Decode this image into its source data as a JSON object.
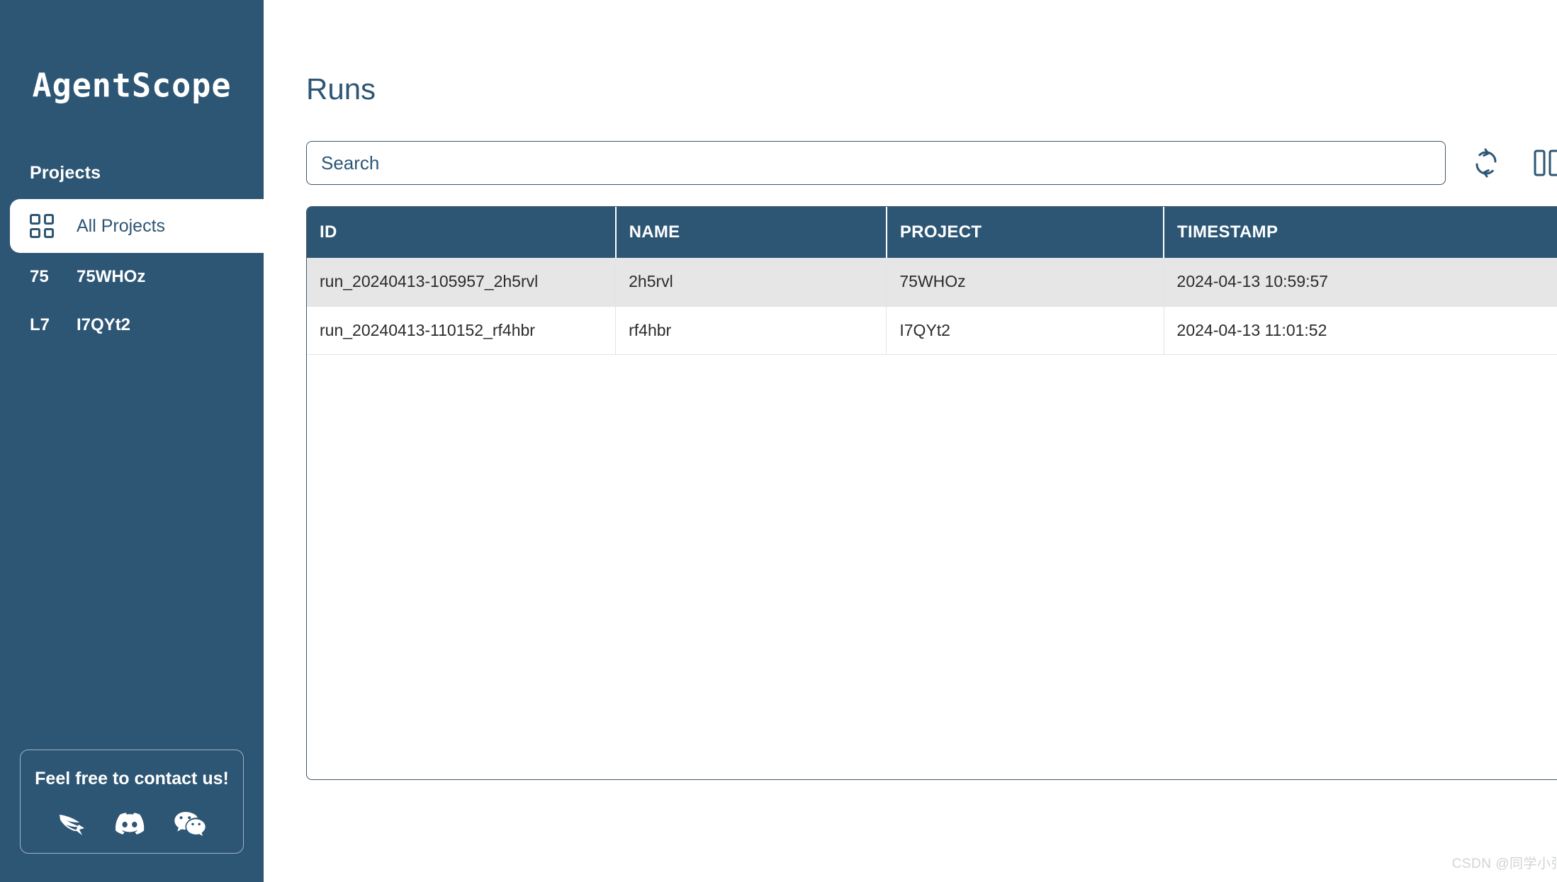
{
  "brand": {
    "logo_text": "AgentScope"
  },
  "sidebar": {
    "section_label": "Projects",
    "items": [
      {
        "abbr": "",
        "label": "All Projects",
        "icon": "grid-icon",
        "active": true
      },
      {
        "abbr": "75",
        "label": "75WHOz",
        "icon": "",
        "active": false
      },
      {
        "abbr": "L7",
        "label": "I7QYt2",
        "icon": "",
        "active": false
      }
    ],
    "contact": {
      "title": "Feel free to contact us!",
      "icons": [
        "dingtalk-icon",
        "discord-icon",
        "wechat-icon"
      ]
    }
  },
  "main": {
    "title": "Runs",
    "search": {
      "placeholder": "Search",
      "value": ""
    },
    "actions": [
      {
        "name": "refresh-icon",
        "label": "Refresh"
      },
      {
        "name": "columns-icon",
        "label": "Columns"
      }
    ],
    "table": {
      "columns": [
        "ID",
        "NAME",
        "PROJECT",
        "TIMESTAMP"
      ],
      "rows": [
        {
          "id": "run_20240413-105957_2h5rvl",
          "name": "2h5rvl",
          "project": "75WHOz",
          "timestamp": "2024-04-13 10:59:57"
        },
        {
          "id": "run_20240413-110152_rf4hbr",
          "name": "rf4hbr",
          "project": "I7QYt2",
          "timestamp": "2024-04-13 11:01:52"
        }
      ]
    }
  },
  "watermark": "CSDN @同学小张",
  "colors": {
    "brand_blue": "#2d5675",
    "row_alt": "#e6e6e6",
    "border": "#41576b",
    "watermark": "#d0d3d6"
  }
}
